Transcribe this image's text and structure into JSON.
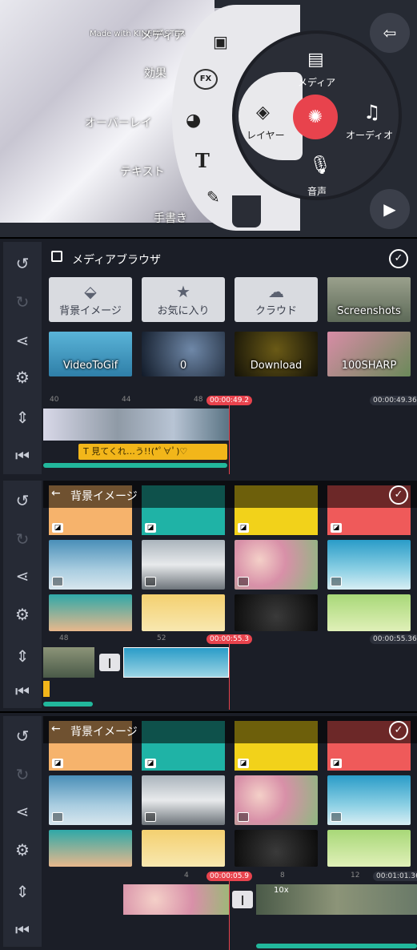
{
  "top": {
    "watermark": "Made with KINEMASTER",
    "fan_items": [
      {
        "icon": "media-frame-icon",
        "label": "メディア"
      },
      {
        "icon": "fx-icon",
        "label": "効果"
      },
      {
        "icon": "sticker-icon",
        "label": "オーバーレイ"
      },
      {
        "icon": "text-icon",
        "label": "テキスト"
      },
      {
        "icon": "brush-icon",
        "label": "手書き"
      }
    ],
    "wheel": {
      "media": "メディア",
      "layer": "レイヤー",
      "audio": "オーディオ",
      "voice": "音声"
    },
    "colors": {
      "record": "#e8434d",
      "wheel": "#2a2d36",
      "wheel_highlight": "#e8e8ea"
    }
  },
  "side_icons": [
    "undo-icon",
    "redo-icon",
    "share-icon",
    "settings-icon",
    "timeline-expand-icon",
    "jump-start-icon"
  ],
  "browser1": {
    "title": "メディアブラウザ",
    "folders": [
      "背景イメージ",
      "お気に入り",
      "クラウド",
      "Screenshots",
      "VideoToGif",
      "0",
      "Download",
      "100SHARP"
    ],
    "ruler": [
      "40",
      "44",
      "48"
    ],
    "playhead_time": "00:00:49.2",
    "total_time": "00:00:49.36",
    "text_clip": "見てくれ…う!!(*ﾟ∀ﾟ)♡"
  },
  "browser2": {
    "title": "背景イメージ",
    "ruler": [
      "48",
      "52"
    ],
    "playhead_time": "00:00:55.3",
    "total_time": "00:00:55.36",
    "colors": [
      "#f6b36c",
      "#1fb3a6",
      "#f2d21a",
      "#ef5a5a"
    ]
  },
  "browser3": {
    "title": "背景イメージ",
    "ruler": [
      "4",
      "8",
      "12"
    ],
    "playhead_time": "00:00:05.9",
    "total_time": "00:01:01.36",
    "speed": "10x",
    "colors": [
      "#f6b36c",
      "#1fb3a6",
      "#f2d21a",
      "#ef5a5a"
    ]
  }
}
